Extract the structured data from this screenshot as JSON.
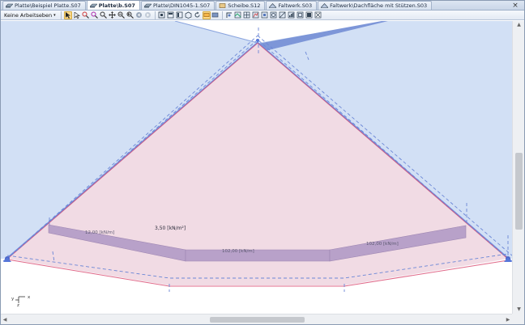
{
  "tabs": [
    {
      "label": "Platte\\Beispiel Platte.S07",
      "active": false,
      "icon": "plate-icon"
    },
    {
      "label": "Platte\\b.S07",
      "active": true,
      "icon": "plate-icon"
    },
    {
      "label": "Platte\\DIN1045-1.S07",
      "active": false,
      "icon": "plate-icon"
    },
    {
      "label": "Scheibe.S12",
      "active": false,
      "icon": "wall-icon"
    },
    {
      "label": "Faltwerk.S03",
      "active": false,
      "icon": "folded-plate-icon"
    },
    {
      "label": "Faltwerk\\Dachfläche mit Stützen.S03",
      "active": false,
      "icon": "folded-plate-icon"
    }
  ],
  "tab_close_label": "×",
  "toolbar": {
    "workplane_label": "Keine Arbeitseben",
    "workplane_caret": "▾"
  },
  "canvas": {
    "line_loads": [
      {
        "label": "12,00 [kN/m]"
      },
      {
        "label": "102,00 [kN/m]"
      },
      {
        "label": "102,00 [kN/m]"
      }
    ],
    "area_load_label": "3,50 [kN/m²]",
    "axes": {
      "x": "x",
      "y": "y",
      "z": "z"
    }
  },
  "colors": {
    "plate_fill": "#f0dbe4",
    "plate_edge": "#c84a73",
    "roof_fill": "#cddcf3",
    "dashed": "#6a86d6",
    "load_band": "#b9a0c8",
    "tab_active_bg": "#ffffff",
    "tab_bar_bg": "#c9d6e8"
  },
  "scrollbars": {
    "up": "▲",
    "down": "▼",
    "left": "◀",
    "right": "▶"
  }
}
